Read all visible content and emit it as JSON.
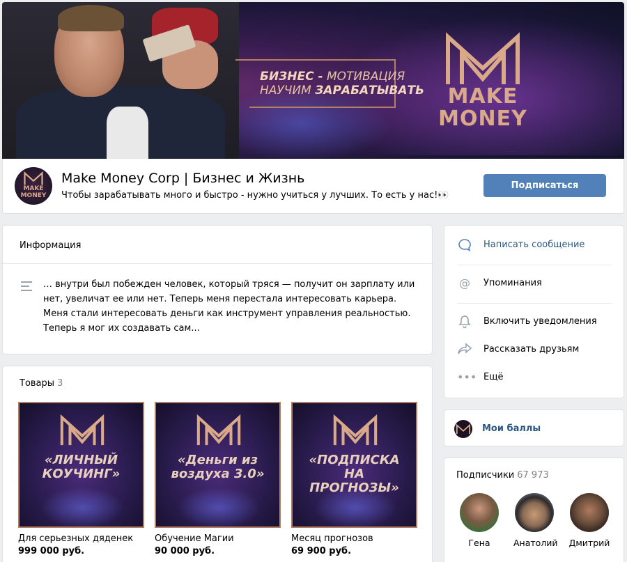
{
  "cover": {
    "slogan_line1_a": "БИЗНЕС -",
    "slogan_line1_b": " МОТИВАЦИЯ",
    "slogan_line2_a": "НАУЧИМ ",
    "slogan_line2_b": "ЗАРАБАТЫВАТЬ",
    "logo_line1": "MAKE",
    "logo_line2": "MONEY"
  },
  "header": {
    "avatar_line1": "MAKE",
    "avatar_line2": "MONEY",
    "name": "Make Money Corp | Бизнес и Жизнь",
    "status": "Чтобы зарабатывать много и быстро - нужно учиться у лучших. То есть у нас!👀",
    "subscribe_label": "Подписаться"
  },
  "info": {
    "title": "Информация",
    "description": "… внутри был побежден человек, который тряся — получит он зарплату или нет, увеличат ее или нет. Теперь меня перестала интересовать карьера. Меня стали интересовать деньги как инструмент управления реальностью. Теперь я мог их создавать сам..."
  },
  "goods": {
    "title": "Товары",
    "count": "3",
    "items": [
      {
        "image_title_1": "«ЛИЧНЫЙ",
        "image_title_2": "КОУЧИНГ»",
        "name": "Для серьезных дяденек",
        "price": "999 000 руб."
      },
      {
        "image_title_1": "«Деньги из",
        "image_title_2": "воздуха 3.0»",
        "name": "Обучение Магии",
        "price": "90 000 руб."
      },
      {
        "image_title_1": "«ПОДПИСКА НА",
        "image_title_2": "ПРОГНОЗЫ»",
        "name": "Месяц прогнозов",
        "price": "69 900 руб."
      }
    ]
  },
  "actions": {
    "message": "Написать сообщение",
    "mentions": "Упоминания",
    "notifications": "Включить уведомления",
    "share": "Рассказать друзьям",
    "more": "Ещё"
  },
  "points": {
    "label": "Мои баллы"
  },
  "subscribers": {
    "title": "Подписчики",
    "count": "67 973",
    "people": [
      {
        "name": "Гена"
      },
      {
        "name": "Анатолий"
      },
      {
        "name": "Дмитрий"
      }
    ]
  },
  "colors": {
    "accent": "#5181b8",
    "link": "#2a5885",
    "gold": "#d9a98a",
    "background": "#edeef0"
  }
}
